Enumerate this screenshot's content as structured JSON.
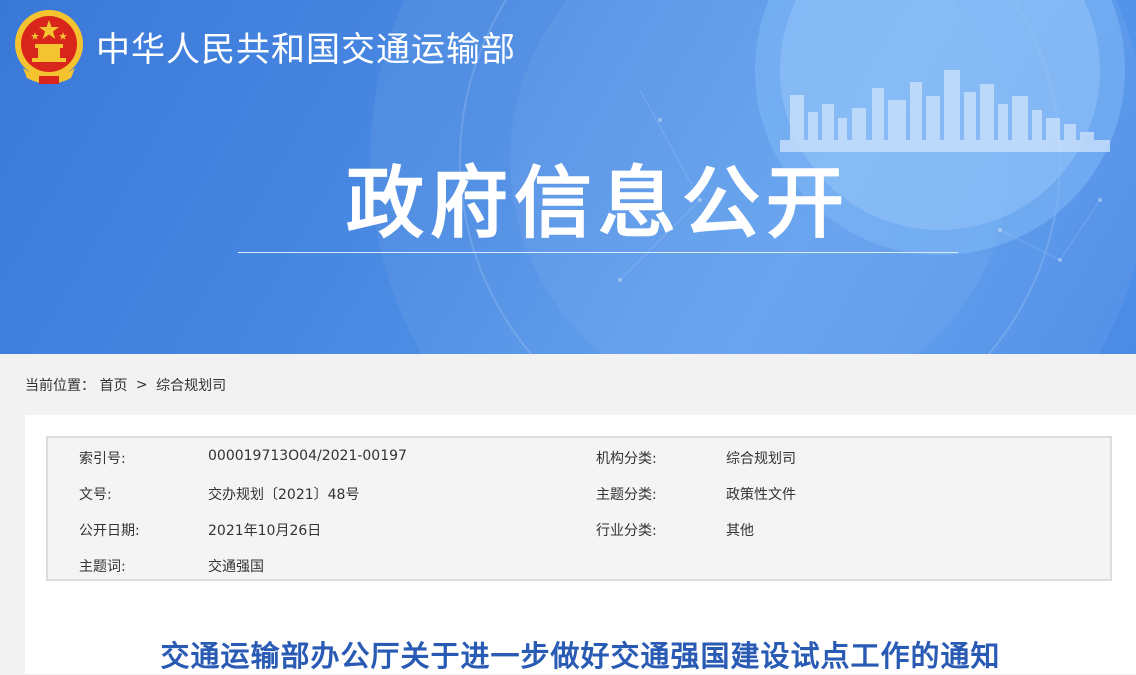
{
  "header": {
    "site_title": "中华人民共和国交通运输部",
    "banner_heading": "政府信息公开"
  },
  "breadcrumb": {
    "prefix": "当前位置：",
    "items": [
      "首页",
      "综合规划司"
    ],
    "separator": ">"
  },
  "meta": {
    "index_no_label": "索引号:",
    "index_no_value": "000019713O04/2021-00197",
    "org_label": "机构分类:",
    "org_value": "综合规划司",
    "doc_no_label": "文号:",
    "doc_no_value": "交办规划〔2021〕48号",
    "topic_label": "主题分类:",
    "topic_value": "政策性文件",
    "date_label": "公开日期:",
    "date_value": "2021年10月26日",
    "industry_label": "行业分类:",
    "industry_value": "其他",
    "keywords_label": "主题词:",
    "keywords_value": "交通强国"
  },
  "document": {
    "title": "交通运输部办公厅关于进一步做好交通强国建设试点工作的通知"
  },
  "colors": {
    "banner_blue": "#4a8be6",
    "title_blue": "#2a5bb4",
    "emblem_red": "#d9261c",
    "emblem_gold": "#f4c430"
  }
}
